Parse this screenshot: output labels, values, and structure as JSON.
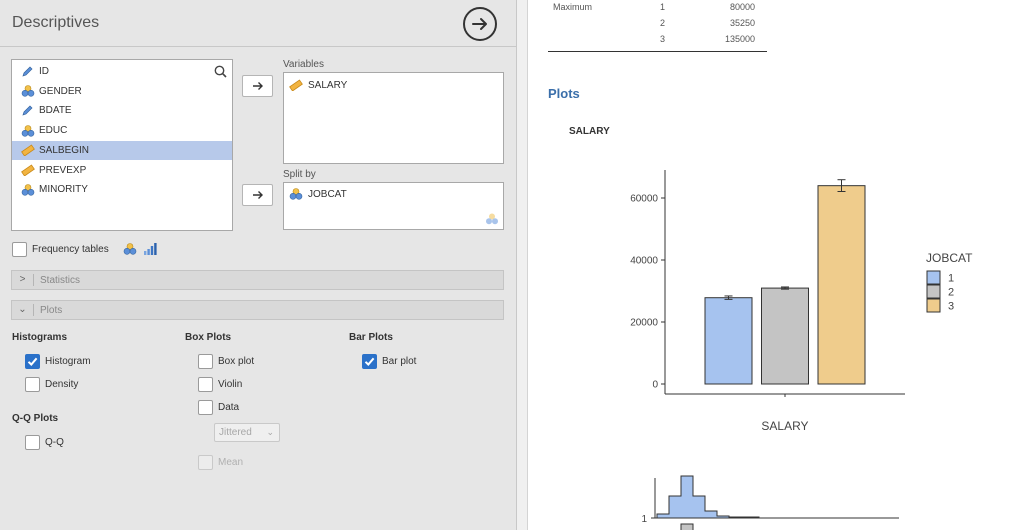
{
  "header": {
    "title": "Descriptives"
  },
  "variables": [
    {
      "name": "ID",
      "type": "nominal-text",
      "selected": false
    },
    {
      "name": "GENDER",
      "type": "nominal",
      "selected": false
    },
    {
      "name": "BDATE",
      "type": "nominal-text",
      "selected": false
    },
    {
      "name": "EDUC",
      "type": "nominal",
      "selected": false
    },
    {
      "name": "SALBEGIN",
      "type": "continuous",
      "selected": true
    },
    {
      "name": "PREVEXP",
      "type": "continuous",
      "selected": false
    },
    {
      "name": "MINORITY",
      "type": "nominal",
      "selected": false
    }
  ],
  "targets": {
    "variables_label": "Variables",
    "variables_items": [
      "SALARY"
    ],
    "splitby_label": "Split by",
    "splitby_items": [
      "JOBCAT"
    ]
  },
  "options": {
    "frequency_tables": {
      "label": "Frequency tables",
      "checked": false
    },
    "statistics_section": "Statistics",
    "plots_section": "Plots"
  },
  "plots_options": {
    "histograms_heading": "Histograms",
    "histogram": {
      "label": "Histogram",
      "checked": true
    },
    "density": {
      "label": "Density",
      "checked": false
    },
    "qq_heading": "Q-Q Plots",
    "qq": {
      "label": "Q-Q",
      "checked": false
    },
    "boxplots_heading": "Box Plots",
    "box_plot": {
      "label": "Box plot",
      "checked": false
    },
    "violin": {
      "label": "Violin",
      "checked": false
    },
    "data": {
      "label": "Data",
      "checked": false
    },
    "data_mode": "Jittered",
    "mean": {
      "label": "Mean",
      "checked": false
    },
    "barplots_heading": "Bar Plots",
    "bar_plot": {
      "label": "Bar plot",
      "checked": true
    }
  },
  "results": {
    "table": {
      "rows": [
        {
          "stat": "Maximum",
          "group": "1",
          "value": "80000"
        },
        {
          "stat": "",
          "group": "2",
          "value": "35250"
        },
        {
          "stat": "",
          "group": "3",
          "value": "135000"
        }
      ]
    },
    "plots_heading": "Plots",
    "plot_title": "SALARY"
  },
  "chart_data": [
    {
      "type": "bar",
      "title": "",
      "xlabel": "SALARY",
      "ylabel": "",
      "legend_title": "JOBCAT",
      "legend_position": "right",
      "categories": [
        "1",
        "2",
        "3"
      ],
      "values": [
        27838,
        30939,
        63978
      ],
      "error_low": [
        27300,
        30600,
        62100
      ],
      "error_high": [
        28400,
        31300,
        65900
      ],
      "colors": [
        "#a6c3ef",
        "#c4c4c4",
        "#efcc8c"
      ],
      "y_ticks": [
        0,
        20000,
        40000,
        60000
      ],
      "ylim": [
        0,
        68000
      ],
      "grid": false
    },
    {
      "type": "histogram",
      "title": "",
      "y_tick_labels": [
        "1"
      ],
      "grid": false
    }
  ],
  "colors": {
    "accent": "#2a71c9",
    "heading": "#3b6faa",
    "selected_row": "#b7c9ea"
  }
}
